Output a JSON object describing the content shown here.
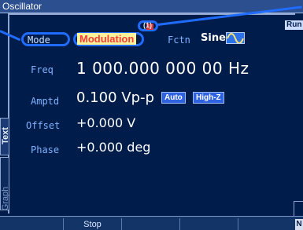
{
  "window": {
    "title": "Oscillator"
  },
  "status": {
    "indicator": "(1)",
    "run": "Run"
  },
  "tabs": [
    "Text",
    "Graph"
  ],
  "params": {
    "mode": {
      "label": "Mode",
      "value": "Modulation"
    },
    "fctn": {
      "label": "Fctn",
      "value": "Sine",
      "icon": "sine-wave-icon"
    },
    "freq": {
      "label": "Freq",
      "value": "1 000.000 000 00 Hz"
    },
    "amptd": {
      "label": "Amptd",
      "value": "0.100 Vp-p",
      "badges": [
        "Auto",
        "High-Z"
      ]
    },
    "offset": {
      "label": "Offset",
      "value": "+0.000 V"
    },
    "phase": {
      "label": "Phase",
      "value": "+0.000 deg"
    }
  },
  "softkeys": [
    "",
    "Stop",
    "",
    "",
    "",
    "N"
  ],
  "colors": {
    "background": "#001c4a",
    "label": "#7fb2ff",
    "mode_value": "#ff3a3a",
    "highlight_ring": "#1f6cff",
    "badge": "#2e62e0"
  }
}
